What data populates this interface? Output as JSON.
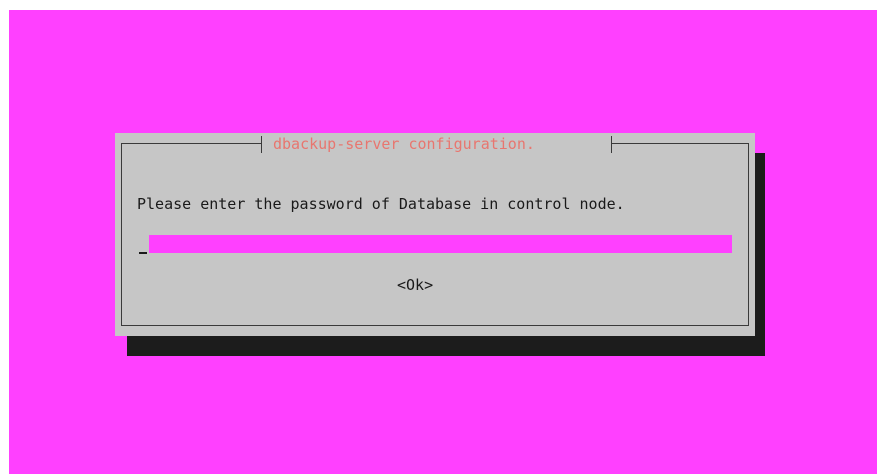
{
  "dialog": {
    "title": "dbackup-server configuration.",
    "prompt": "Please enter the password of Database in control node.",
    "password_value": "",
    "ok_label": "<Ok>"
  },
  "colors": {
    "terminal_background": "#ff40ff",
    "dialog_background": "#c6c6c6",
    "title_color": "#e8766f",
    "input_background": "#ff40ff",
    "shadow": "#1c1c1c"
  }
}
